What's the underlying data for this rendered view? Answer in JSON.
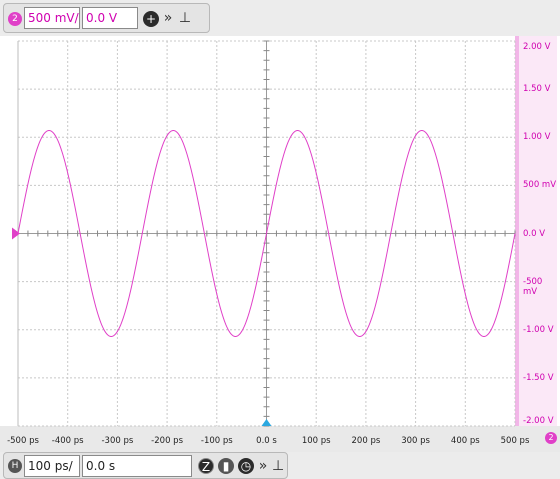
{
  "channel": {
    "badge": "2",
    "scale": "500 mV/",
    "offset": "0.0 V",
    "add_icon": "plus-circle-icon",
    "expand_icon": "double-chevron-right-icon",
    "pin_icon": "pin-icon"
  },
  "y_axis": {
    "labels": [
      "2.00 V",
      "1.50 V",
      "1.00 V",
      "500 mV",
      "0.0 V",
      "-500 mV",
      "-1.00 V",
      "-1.50 V",
      "-2.00 V"
    ]
  },
  "x_axis": {
    "labels": [
      "-500 ps",
      "-400 ps",
      "-300 ps",
      "-200 ps",
      "-100 ps",
      "0.0 s",
      "100 ps",
      "200 ps",
      "300 ps",
      "400 ps",
      "500 ps"
    ]
  },
  "horizontal": {
    "badge": "H",
    "scale": "100 ps/",
    "position": "0.0 s",
    "zoom_icon": "zoom-icon",
    "acquire_icon": "acquire-icon",
    "clock_icon": "clock-icon",
    "expand_icon": "double-chevron-right-icon",
    "pin_icon": "pin-icon"
  },
  "channel_indicator": "2",
  "colors": {
    "trace": "#e040c8",
    "trigger_marker": "#2aa8e0"
  },
  "chart_data": {
    "type": "line",
    "title": "",
    "xlabel": "",
    "ylabel": "",
    "x_unit": "ps",
    "y_unit": "V",
    "xlim": [
      -500,
      500
    ],
    "ylim": [
      -2.0,
      2.0
    ],
    "grid": true,
    "series": [
      {
        "waveform": "sine",
        "amplitude_v": 1.07,
        "period_ps": 250,
        "zero_crossings_ps": [
          -500,
          -375,
          -250,
          -125,
          0,
          125,
          250,
          375,
          500
        ],
        "peaks_ps": [
          -437.5,
          -187.5,
          62.5,
          312.5
        ],
        "troughs_ps": [
          -312.5,
          -62.5,
          187.5,
          437.5
        ]
      }
    ]
  }
}
